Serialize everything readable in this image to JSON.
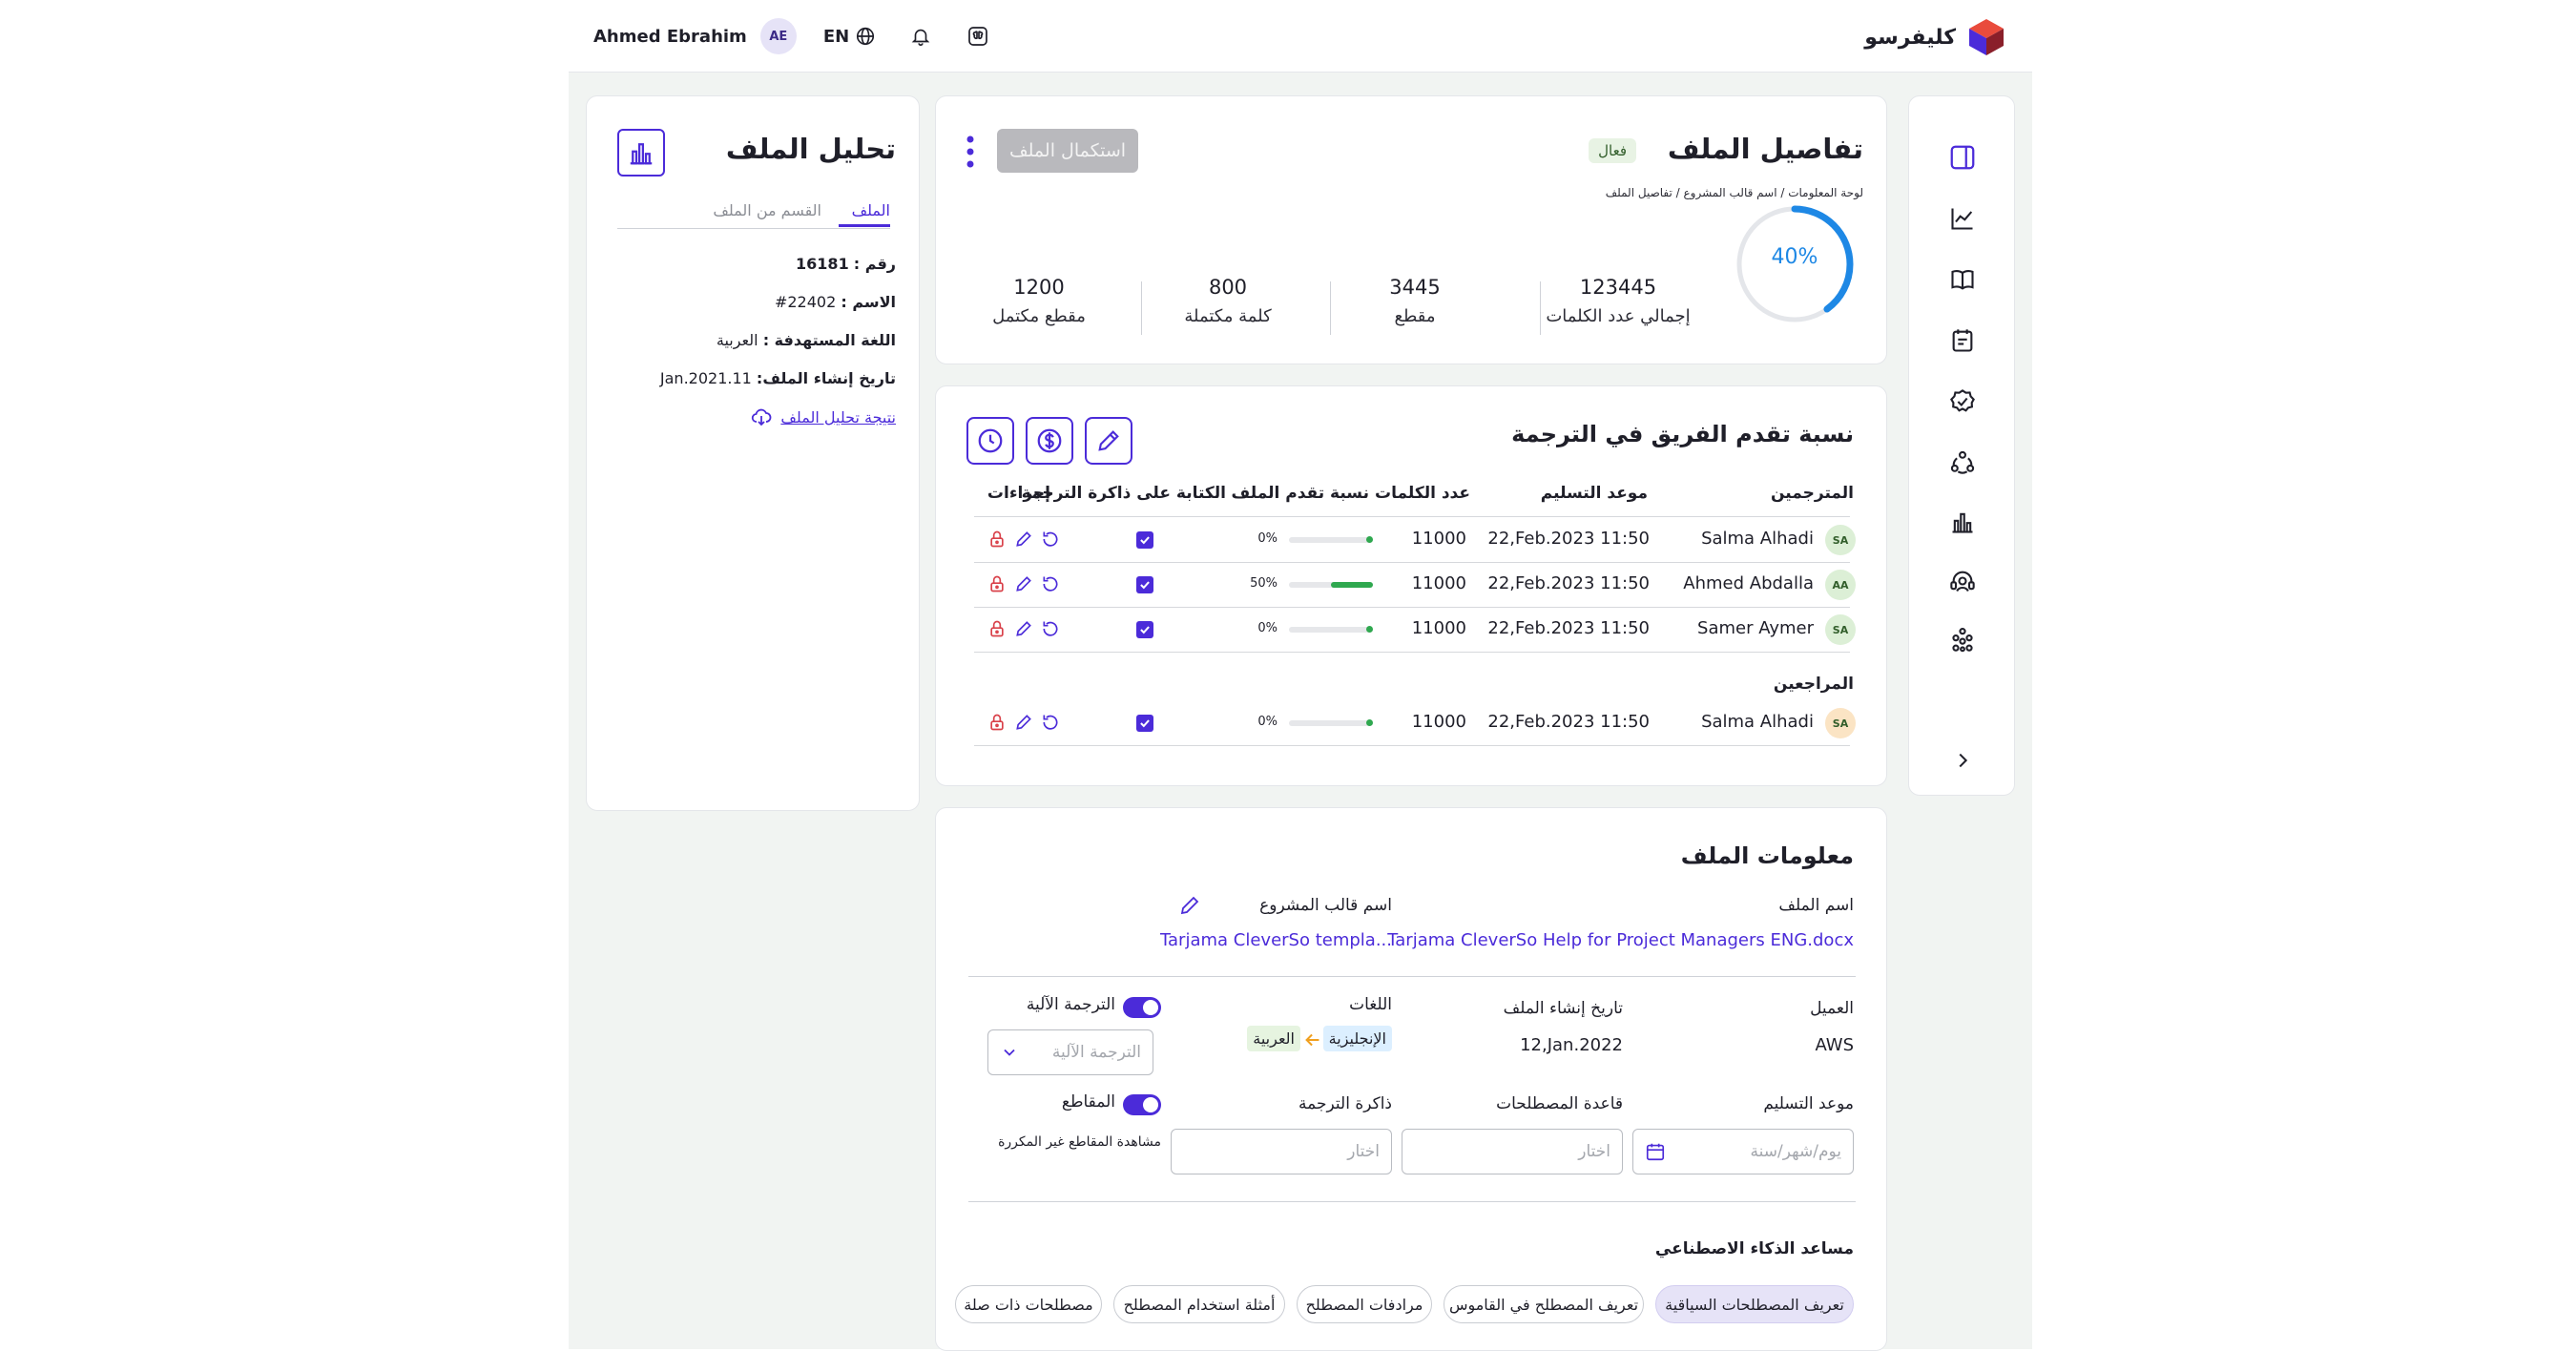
{
  "header": {
    "user_name": "Ahmed Ebrahim",
    "user_initials": "AE",
    "language": "EN",
    "brand_name": "كليفرسو",
    "icons": [
      "globe-icon",
      "bell-icon",
      "ai-brain-icon"
    ]
  },
  "sidebar": {
    "items": [
      "panel-icon",
      "trend-chart-icon",
      "book-icon",
      "notes-icon",
      "badge-check-icon",
      "team-icon",
      "bar-chart-icon",
      "support-icon",
      "network-icon"
    ],
    "expand_icon": "chevron-right-icon"
  },
  "file_details": {
    "title": "تفاصيل الملف",
    "status": "فعال",
    "breadcrumb": "لوحة المعلومات / اسم قالب المشروع / تفاصيل الملف",
    "complete_button": "استكمال الملف",
    "progress_percent": 40,
    "progress_label": "40%",
    "stats": [
      {
        "value": "123445",
        "label": "إجمالي عدد الكلمات"
      },
      {
        "value": "3445",
        "label": "مقطع"
      },
      {
        "value": "800",
        "label": "كلمة مكتملة"
      },
      {
        "value": "1200",
        "label": "مقطع مكتمل"
      }
    ]
  },
  "team_progress": {
    "title": "نسبة تقدم الفريق في الترجمة",
    "columns": [
      "المترجمين",
      "موعد التسليم",
      "عدد الكلمات",
      "نسبة تقدم الملف",
      "الكتابة على ذاكرة الترجمة",
      "إجراءات"
    ],
    "translators": [
      {
        "initials": "SA",
        "name": "Salma Alhadi",
        "deadline": "22,Feb.2023  11:50",
        "words": "11000",
        "progress_label": "0%",
        "progress": 0,
        "avatar_color": "#dcefd6"
      },
      {
        "initials": "AA",
        "name": "Ahmed Abdalla",
        "deadline": "22,Feb.2023  11:50",
        "words": "11000",
        "progress_label": "50%",
        "progress": 50,
        "avatar_color": "#dcefd6"
      },
      {
        "initials": "SA",
        "name": "Samer Aymer",
        "deadline": "22,Feb.2023  11:50",
        "words": "11000",
        "progress_label": "0%",
        "progress": 0,
        "avatar_color": "#dcefd6"
      }
    ],
    "reviewers_title": "المراجعين",
    "reviewers": [
      {
        "initials": "SA",
        "name": "Salma Alhadi",
        "deadline": "22,Feb.2023  11:50",
        "words": "11000",
        "progress_label": "0%",
        "progress": 0,
        "avatar_color": "#fbe4c4"
      }
    ]
  },
  "file_info": {
    "title": "معلومات الملف",
    "file_name_label": "اسم الملف",
    "file_name": "Tarjama CleverSo Help for Project Managers ENG.docx",
    "template_label": "اسم قالب المشروع",
    "template_name": "Tarjama CleverSo templa...",
    "client_label": "العميل",
    "client": "AWS",
    "created_label": "تاريخ إنشاء الملف",
    "created": "12,Jan.2022",
    "languages_label": "اللغات",
    "source_lang": "الإنجليزية",
    "target_lang": "العربية",
    "mt_label": "الترجمة الآلية",
    "mt_placeholder": "الترجمة الآلية",
    "deadline_label": "موعد التسليم",
    "deadline_placeholder": "يوم/شهر/سنة",
    "termbase_label": "قاعدة المصطلحات",
    "termbase_placeholder": "اختار",
    "tm_label": "ذاكرة الترجمة",
    "tm_placeholder": "اختار",
    "segments_label": "المقاطع",
    "segments_hint": "مشاهدة المقاطع غير المكررة",
    "ai_title": "مساعد الذكاء الاصطناعي",
    "ai_chips": [
      "تعريف المصطلحات السياقية",
      "تعريف المصطلح في القاموس",
      "مرادفات المصطلح",
      "أمثلة استخدام المصطلح",
      "مصطلحات ذات صلة"
    ]
  },
  "analysis": {
    "title": "تحليل الملف",
    "tabs": [
      "الملف",
      "القسم من الملف"
    ],
    "number_label": "رقم :",
    "number": "16181",
    "name_label": "الاسم :",
    "name": "22402#",
    "target_lang_label": "اللغة المستهدفة :",
    "target_lang": "العربية",
    "created_label": "تاريخ إنشاء الملف:",
    "created": "Jan.2021.11",
    "result_link": "نتيجة تحليل الملف"
  },
  "colors": {
    "accent": "#4b2bd9",
    "progress": "#1e88e5",
    "success": "#2fa84f",
    "danger": "#d9414a"
  }
}
